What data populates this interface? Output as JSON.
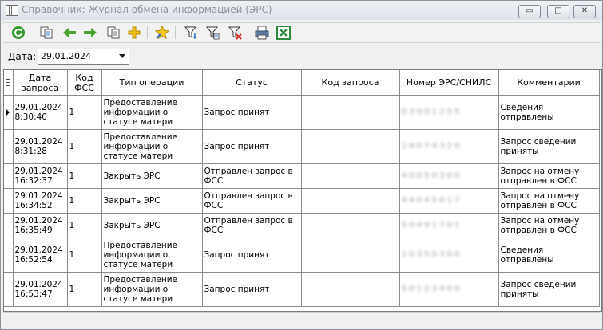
{
  "window": {
    "title": "Справочник: Журнал обмена информацией (ЭРС)",
    "buttons": {
      "minimize": "▭",
      "maximize": "□",
      "close": "✕"
    }
  },
  "toolbar": {
    "icons": [
      "refresh-icon",
      "copy-record-icon",
      "arrow-left-icon",
      "arrow-right-icon",
      "paste-record-icon",
      "add-icon",
      "favorite-icon",
      "filter-icon",
      "filter-edit-icon",
      "filter-clear-icon",
      "print-icon",
      "excel-export-icon"
    ]
  },
  "date": {
    "label": "Дата:",
    "value": "29.01.2024"
  },
  "table": {
    "headers": {
      "date": "Дата запроса",
      "fss_code": "Код ФСС",
      "operation": "Тип операции",
      "status": "Статус",
      "request_code": "Код запроса",
      "ers_number": "Номер ЭРС/СНИЛС",
      "comments": "Комментарии"
    },
    "rows": [
      {
        "date": "29.01.2024 8:30:40",
        "fss_code": "1",
        "operation": "Предоставление информации о статусе матери",
        "status": "Запрос принят",
        "request_code": "",
        "ers_number": "0·3·9·0·1·2·5·5",
        "comment": "Сведения отправлены",
        "current": true
      },
      {
        "date": "29.01.2024 8:31:28",
        "fss_code": "1",
        "operation": "Предоставление информации о статусе матери",
        "status": "Запрос принят",
        "request_code": "",
        "ers_number": "1·9·0·7·4·3·2·0",
        "comment": "Запрос сведении приняты",
        "current": false
      },
      {
        "date": "29.01.2024 16:32:37",
        "fss_code": "1",
        "operation": "Закрыть ЭРС",
        "status": "Отправлен запрос в ФСС",
        "request_code": "",
        "ers_number": "4·0·0·5·0·3·0·0",
        "comment": "Запрос на отмену отправлен в ФСС",
        "current": false
      },
      {
        "date": "29.01.2024 16:34:52",
        "fss_code": "1",
        "operation": "Закрыть ЭРС",
        "status": "Отправлен запрос в ФСС",
        "request_code": "",
        "ers_number": "4·4·0·4·5·0·1·7",
        "comment": "Запрос на отмену отправлен в ФСС",
        "current": false
      },
      {
        "date": "29.01.2024 16:35:49",
        "fss_code": "1",
        "operation": "Закрыть ЭРС",
        "status": "Отправлен запрос в ФСС",
        "request_code": "",
        "ers_number": "5·0·4·9·1·7·0·1",
        "comment": "Запрос на отмену отправлен в ФСС",
        "current": false
      },
      {
        "date": "29.01.2024 16:52:54",
        "fss_code": "1",
        "operation": "Предоставление информации о статусе матери",
        "status": "Запрос принят",
        "request_code": "",
        "ers_number": "1·0·3·5·0·3·0·0",
        "comment": "Сведения отправлены",
        "current": false
      },
      {
        "date": "29.01.2024 16:53:47",
        "fss_code": "1",
        "operation": "Предоставление информации о статусе матери",
        "status": "Запрос принят",
        "request_code": "",
        "ers_number": "5·0·1·2·3·4·0·0",
        "comment": "Запрос сведении приняты",
        "current": false
      }
    ]
  }
}
